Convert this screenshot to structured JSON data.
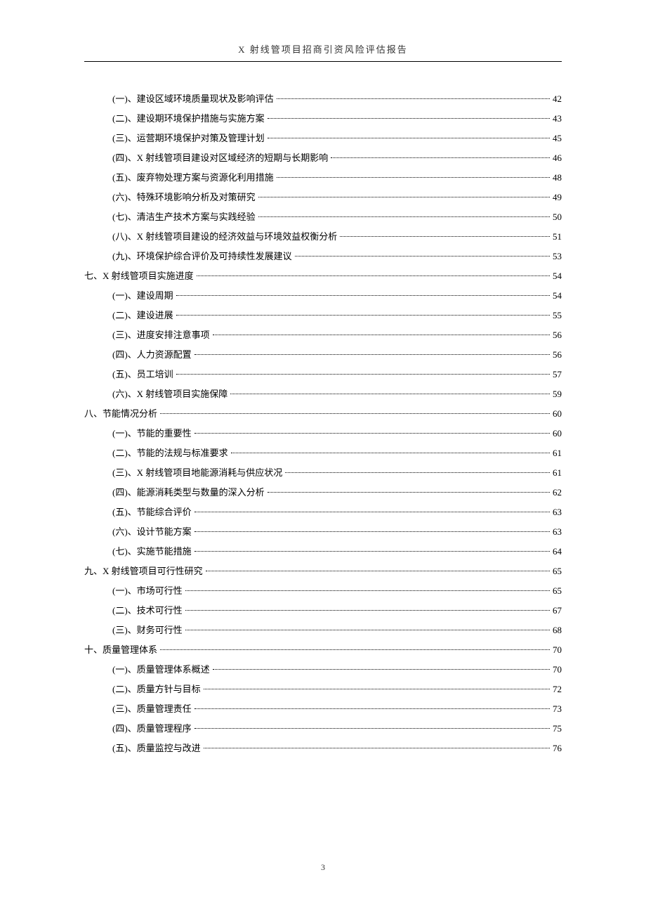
{
  "header": "X 射线管项目招商引资风险评估报告",
  "page_number": "3",
  "toc_items": [
    {
      "level": "sub",
      "label": "(一)、建设区域环境质量现状及影响评估",
      "page": "42"
    },
    {
      "level": "sub",
      "label": "(二)、建设期环境保护措施与实施方案",
      "page": "43"
    },
    {
      "level": "sub",
      "label": "(三)、运营期环境保护对策及管理计划",
      "page": "45"
    },
    {
      "level": "sub",
      "label": "(四)、X 射线管项目建设对区域经济的短期与长期影响",
      "page": "46"
    },
    {
      "level": "sub",
      "label": "(五)、废弃物处理方案与资源化利用措施",
      "page": "48"
    },
    {
      "level": "sub",
      "label": "(六)、特殊环境影响分析及对策研究",
      "page": "49"
    },
    {
      "level": "sub",
      "label": "(七)、清洁生产技术方案与实践经验",
      "page": "50"
    },
    {
      "level": "sub",
      "label": "(八)、X 射线管项目建设的经济效益与环境效益权衡分析",
      "page": "51"
    },
    {
      "level": "sub",
      "label": "(九)、环境保护综合评价及可持续性发展建议",
      "page": "53"
    },
    {
      "level": "main",
      "label": "七、X 射线管项目实施进度",
      "page": "54"
    },
    {
      "level": "sub",
      "label": "(一)、建设周期",
      "page": "54"
    },
    {
      "level": "sub",
      "label": "(二)、建设进展",
      "page": "55"
    },
    {
      "level": "sub",
      "label": "(三)、进度安排注意事项",
      "page": "56"
    },
    {
      "level": "sub",
      "label": "(四)、人力资源配置",
      "page": "56"
    },
    {
      "level": "sub",
      "label": "(五)、员工培训",
      "page": "57"
    },
    {
      "level": "sub",
      "label": "(六)、X 射线管项目实施保障",
      "page": "59"
    },
    {
      "level": "main",
      "label": "八、节能情况分析",
      "page": "60"
    },
    {
      "level": "sub",
      "label": "(一)、节能的重要性",
      "page": "60"
    },
    {
      "level": "sub",
      "label": "(二)、节能的法规与标准要求",
      "page": "61"
    },
    {
      "level": "sub",
      "label": "(三)、X 射线管项目地能源消耗与供应状况",
      "page": "61"
    },
    {
      "level": "sub",
      "label": "(四)、能源消耗类型与数量的深入分析",
      "page": "62"
    },
    {
      "level": "sub",
      "label": "(五)、节能综合评价",
      "page": "63"
    },
    {
      "level": "sub",
      "label": "(六)、设计节能方案",
      "page": "63"
    },
    {
      "level": "sub",
      "label": "(七)、实施节能措施",
      "page": "64"
    },
    {
      "level": "main",
      "label": "九、X 射线管项目可行性研究",
      "page": "65"
    },
    {
      "level": "sub",
      "label": "(一)、市场可行性",
      "page": "65"
    },
    {
      "level": "sub",
      "label": "(二)、技术可行性",
      "page": "67"
    },
    {
      "level": "sub",
      "label": "(三)、财务可行性",
      "page": "68"
    },
    {
      "level": "main",
      "label": "十、质量管理体系",
      "page": "70"
    },
    {
      "level": "sub",
      "label": "(一)、质量管理体系概述",
      "page": "70"
    },
    {
      "level": "sub",
      "label": "(二)、质量方针与目标",
      "page": "72"
    },
    {
      "level": "sub",
      "label": "(三)、质量管理责任",
      "page": "73"
    },
    {
      "level": "sub",
      "label": "(四)、质量管理程序",
      "page": "75"
    },
    {
      "level": "sub",
      "label": "(五)、质量监控与改进",
      "page": "76"
    }
  ]
}
